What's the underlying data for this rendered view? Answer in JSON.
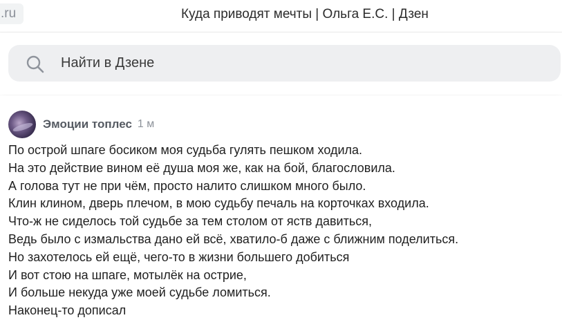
{
  "tab": {
    "url_fragment": ".ru"
  },
  "page": {
    "title": "Куда приводят мечты | Ольга Е.С. | Дзен"
  },
  "search": {
    "placeholder": "Найти в Дзене",
    "icon": "search-icon"
  },
  "post": {
    "author": "Эмоции топлес",
    "age": "1 м",
    "lines": [
      "По острой шпаге босиком моя судьба гулять пешком ходила.",
      "На это действие вином её душа моя же, как на бой, благословила.",
      "А голова тут не при чём, просто налито слишком много было.",
      "Клин клином, дверь плечом, в мою судьбу печаль на корточках входила.",
      "Что-ж не сиделось той судьбе за тем столом от яств давиться,",
      "Ведь было с измальства дано ей всё, хватило-б даже с ближним поделиться.",
      "Но захотелось ей ещё, чего-то в жизни большего добиться",
      "И вот стою на шпаге, мотылёк на острие,",
      "И больше некуда уже моей судьбе ломиться.",
      "Наконец-то дописал"
    ]
  },
  "colors": {
    "search_bg": "#eeeff1",
    "text": "#1f1f1f",
    "muted": "#8d929a"
  }
}
